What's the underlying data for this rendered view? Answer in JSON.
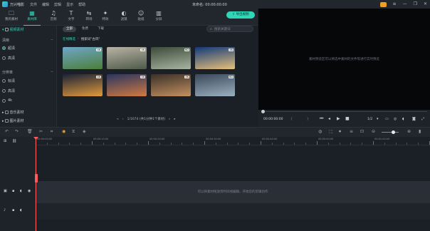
{
  "app": {
    "name": "万兴喵影",
    "doc_title": "未命名: 00:00:00:00"
  },
  "menu": [
    "文件",
    "编辑",
    "剪辑",
    "显示",
    "帮助"
  ],
  "window_controls": [
    "≡",
    "—",
    "❐",
    "✕"
  ],
  "toolbar": {
    "tools": [
      {
        "label": "我的素材",
        "icon": "🗀"
      },
      {
        "label": "素材库",
        "icon": "▦"
      },
      {
        "label": "音频",
        "icon": "♫"
      },
      {
        "label": "文字",
        "icon": "T"
      },
      {
        "label": "转场",
        "icon": "⇆"
      },
      {
        "label": "特效",
        "icon": "✦"
      },
      {
        "label": "滤镜",
        "icon": "◐"
      },
      {
        "label": "贴纸",
        "icon": "☺"
      },
      {
        "label": "分屏",
        "icon": "▥"
      }
    ],
    "active_index": 1,
    "export_label": "导出视频"
  },
  "left_panel": {
    "root": "视频素材",
    "filter_label": "清晰",
    "filter_options": [
      "超清",
      "高清"
    ],
    "filter_selected": 0,
    "ratio_label": "分辨率",
    "ratio_options": [
      "标清",
      "高清",
      "4k"
    ],
    "ratio_selected": 0,
    "categories": [
      "音乐素材",
      "图片素材"
    ]
  },
  "media": {
    "tabs": [
      "全部",
      "免费",
      "下载"
    ],
    "active_tab": 0,
    "search_placeholder": "搜索关键词",
    "breadcrumb_root": "在线精选",
    "breadcrumb_current": "搜索词\"古风\"",
    "thumbs": [
      {
        "badge": "4K",
        "colors": [
          "#6fa6c8",
          "#4b7f3a"
        ]
      },
      {
        "badge": "4K",
        "colors": [
          "#b9b3a6",
          "#4e5a48"
        ]
      },
      {
        "badge": "HD",
        "colors": [
          "#3d4a3a",
          "#a7b5a0"
        ]
      },
      {
        "badge": "4K",
        "colors": [
          "#123a7a",
          "#e6c07a"
        ]
      },
      {
        "badge": "4K",
        "colors": [
          "#1a2238",
          "#e09a3a"
        ]
      },
      {
        "badge": "4K",
        "colors": [
          "#2a3560",
          "#d07a40"
        ]
      },
      {
        "badge": "4K",
        "colors": [
          "#3a3028",
          "#c49060"
        ]
      },
      {
        "badge": "HD",
        "colors": [
          "#3a4858",
          "#9ab0c0"
        ]
      }
    ],
    "pager": "1/1674 (共1分钟1个素材)"
  },
  "preview": {
    "message": "素材预览区可以将选中素材的文件等进行实时预览",
    "timecode": "00:00:00:00",
    "ratio": "1/2"
  },
  "timeline": {
    "ruler_labels": [
      "00:00:00:00",
      "00:00:10:00",
      "00:00:20:00",
      "00:00:30:00",
      "00:00:40:00",
      "00:00:50:00",
      "00:01:00:00"
    ],
    "drop_message": "可以将素材拖放到时间线编辑，开始您的剪辑创作"
  }
}
